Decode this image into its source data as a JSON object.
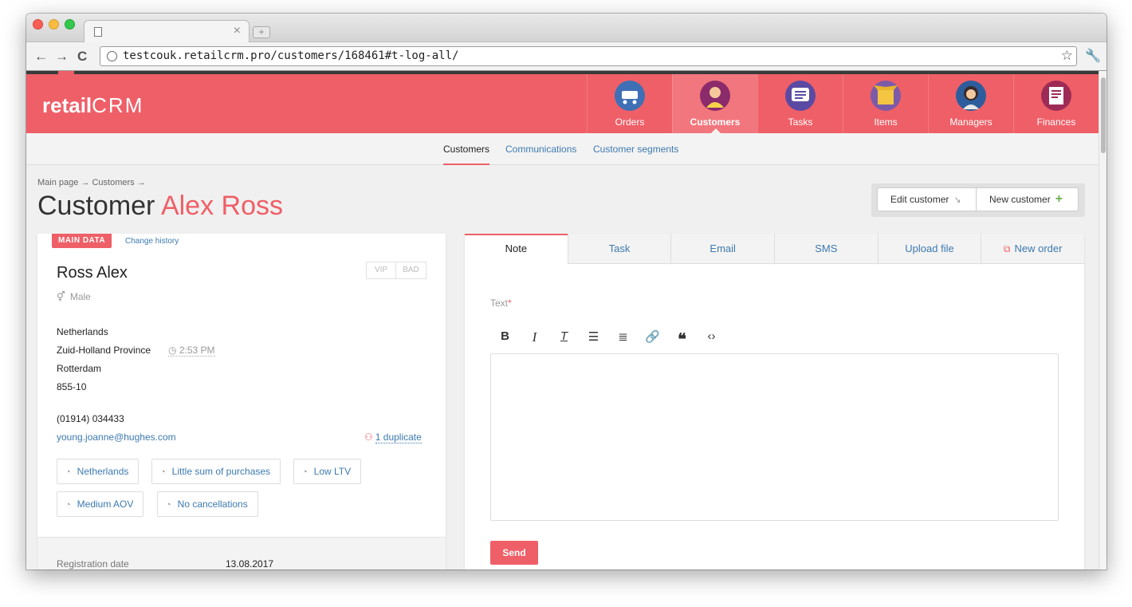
{
  "browser": {
    "url": "testcouk.retailcrm.pro/customers/168461#t-log-all/"
  },
  "app": {
    "logo_prefix": "retail",
    "logo_crm": "CRM"
  },
  "main_nav": [
    {
      "label": "Orders",
      "icon": "cart-icon",
      "color": "#3f6fb5"
    },
    {
      "label": "Customers",
      "icon": "person-icon",
      "color": "#8b2b6b"
    },
    {
      "label": "Tasks",
      "icon": "chat-icon",
      "color": "#5a4aa3"
    },
    {
      "label": "Items",
      "icon": "box-icon",
      "color": "#7b5aa8"
    },
    {
      "label": "Managers",
      "icon": "manager-icon",
      "color": "#2d5d9c"
    },
    {
      "label": "Finances",
      "icon": "document-icon",
      "color": "#9d2b55"
    }
  ],
  "sub_nav": [
    {
      "label": "Customers"
    },
    {
      "label": "Communications"
    },
    {
      "label": "Customer segments"
    }
  ],
  "breadcrumb": "Main page → Customers →",
  "title": {
    "prefix": "Customer",
    "name": "Alex Ross"
  },
  "actions": {
    "edit": "Edit customer",
    "new": "New customer"
  },
  "customer": {
    "badge": "MAIN DATA",
    "change_history": "Change history",
    "flags": [
      "VIP",
      "BAD"
    ],
    "name": "Ross Alex",
    "gender": "Male",
    "country": "Netherlands",
    "province": "Zuid-Holland Province",
    "local_time": "2:53 PM",
    "city": "Rotterdam",
    "address": "855-10",
    "phone": "(01914) 034433",
    "email": "young.joanne@hughes.com",
    "duplicates": "1 duplicate",
    "segments": [
      "Netherlands",
      "Little sum of purchases",
      "Low LTV",
      "Medium AOV",
      "No cancellations"
    ],
    "registration_label": "Registration date",
    "registration_value": "13.08.2017"
  },
  "panel": {
    "tabs": [
      "Note",
      "Task",
      "Email",
      "SMS",
      "Upload file",
      "New order"
    ],
    "text_label": "Text",
    "required_mark": "*",
    "send": "Send"
  },
  "colors": {
    "brand": "#ef5f67",
    "link": "#3d7ab0"
  }
}
